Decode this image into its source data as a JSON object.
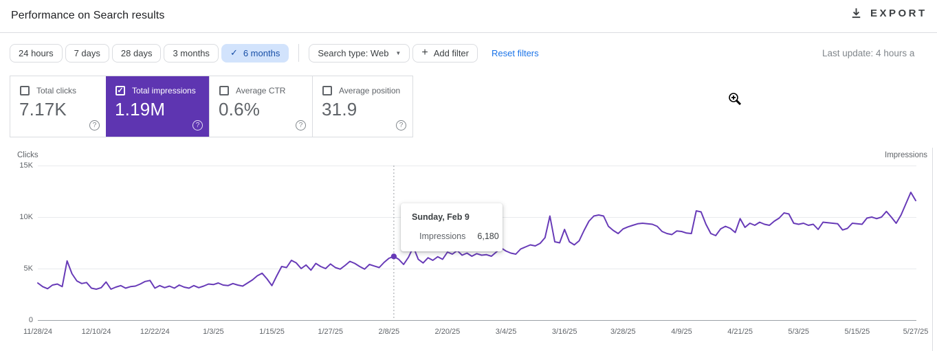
{
  "header": {
    "title": "Performance on Search results",
    "export_label": "EXPORT"
  },
  "filters": {
    "ranges": [
      {
        "label": "24 hours",
        "selected": false
      },
      {
        "label": "7 days",
        "selected": false
      },
      {
        "label": "28 days",
        "selected": false
      },
      {
        "label": "3 months",
        "selected": false
      },
      {
        "label": "6 months",
        "selected": true
      }
    ],
    "search_type_label": "Search type: Web",
    "add_filter_label": "Add filter",
    "reset_label": "Reset filters",
    "last_update": "Last update: 4 hours a"
  },
  "icons": {
    "check": "✓",
    "plus": "+",
    "caret": "▼",
    "question": "?"
  },
  "metrics": [
    {
      "label": "Total clicks",
      "value": "7.17K",
      "checked": false,
      "selected": false
    },
    {
      "label": "Total impressions",
      "value": "1.19M",
      "checked": true,
      "selected": true,
      "color": "#5e35b1"
    },
    {
      "label": "Average CTR",
      "value": "0.6%",
      "checked": false,
      "selected": false
    },
    {
      "label": "Average position",
      "value": "31.9",
      "checked": false,
      "selected": false
    }
  ],
  "chart": {
    "left_axis_label": "Clicks",
    "right_axis_label": "Impressions",
    "y_ticks": [
      "15K",
      "10K",
      "5K",
      "0"
    ]
  },
  "tooltip": {
    "title": "Sunday, Feb 9",
    "series_label": "Impressions",
    "value": "6,180"
  },
  "chart_data": {
    "type": "line",
    "title": "Impressions over time (6 months)",
    "x_start_date": "11/28/24",
    "x_end_date": "5/27/25",
    "x_tick_days": [
      0,
      12,
      24,
      36,
      48,
      60,
      72,
      84,
      96,
      108,
      120,
      132,
      144,
      156,
      168,
      180
    ],
    "x_tick_labels": [
      "11/28/24",
      "12/10/24",
      "12/22/24",
      "1/3/25",
      "1/15/25",
      "1/27/25",
      "2/8/25",
      "2/20/25",
      "3/4/25",
      "3/16/25",
      "3/28/25",
      "4/9/25",
      "4/21/25",
      "5/3/25",
      "5/15/25",
      "5/27/25"
    ],
    "ylim_thousands": [
      0,
      15
    ],
    "grid": true,
    "unit": "daily impressions, values in thousands (K)",
    "series": [
      {
        "name": "Impressions",
        "color": "#673ab7",
        "values_thousands": [
          3.6,
          3.25,
          3.05,
          3.4,
          3.5,
          3.25,
          5.75,
          4.5,
          3.8,
          3.55,
          3.65,
          3.1,
          3.0,
          3.15,
          3.7,
          3.0,
          3.2,
          3.35,
          3.1,
          3.25,
          3.3,
          3.5,
          3.75,
          3.85,
          3.1,
          3.35,
          3.15,
          3.3,
          3.1,
          3.4,
          3.2,
          3.1,
          3.35,
          3.15,
          3.3,
          3.5,
          3.45,
          3.6,
          3.4,
          3.35,
          3.55,
          3.4,
          3.3,
          3.6,
          3.9,
          4.3,
          4.55,
          4.0,
          3.35,
          4.3,
          5.2,
          5.1,
          5.8,
          5.55,
          5.0,
          5.35,
          4.85,
          5.5,
          5.2,
          5.0,
          5.45,
          5.1,
          4.95,
          5.3,
          5.7,
          5.5,
          5.2,
          4.95,
          5.4,
          5.25,
          5.1,
          5.6,
          6.0,
          6.18,
          5.9,
          5.4,
          6.1,
          7.1,
          5.9,
          5.55,
          6.05,
          5.8,
          6.15,
          5.9,
          6.6,
          6.4,
          6.75,
          6.3,
          6.5,
          6.2,
          6.45,
          6.3,
          6.35,
          6.2,
          6.6,
          7.0,
          6.7,
          6.5,
          6.4,
          6.9,
          7.1,
          7.3,
          7.2,
          7.45,
          8.0,
          10.1,
          7.6,
          7.5,
          8.8,
          7.6,
          7.3,
          7.7,
          8.7,
          9.6,
          10.1,
          10.2,
          10.1,
          9.1,
          8.7,
          8.4,
          8.85,
          9.05,
          9.2,
          9.35,
          9.4,
          9.35,
          9.3,
          9.1,
          8.6,
          8.4,
          8.3,
          8.65,
          8.6,
          8.45,
          8.4,
          10.6,
          10.5,
          9.3,
          8.4,
          8.2,
          8.85,
          9.1,
          8.9,
          8.5,
          9.85,
          9.0,
          9.4,
          9.2,
          9.5,
          9.3,
          9.2,
          9.6,
          9.9,
          10.4,
          10.3,
          9.4,
          9.3,
          9.4,
          9.2,
          9.3,
          8.8,
          9.5,
          9.45,
          9.4,
          9.35,
          8.75,
          8.9,
          9.4,
          9.35,
          9.3,
          9.9,
          10.0,
          9.85,
          10.0,
          10.55,
          10.0,
          9.4,
          10.2,
          11.3,
          12.4,
          11.6
        ]
      }
    ],
    "highlight": {
      "day_index": 73,
      "date_label": "Sunday, Feb 9",
      "value": 6180
    }
  }
}
